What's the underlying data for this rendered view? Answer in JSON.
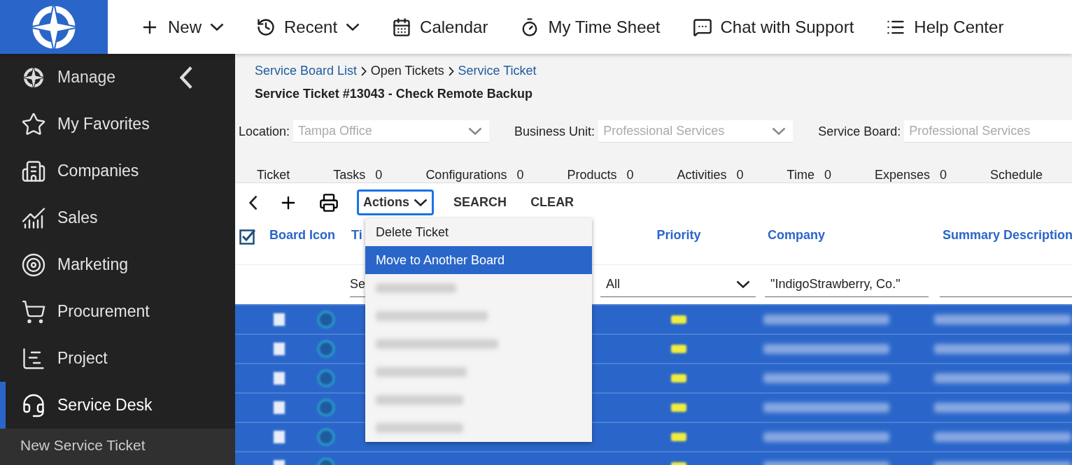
{
  "top_nav": [
    {
      "label": "New",
      "dropdown": true
    },
    {
      "label": "Recent",
      "dropdown": true
    },
    {
      "label": "Calendar",
      "dropdown": false
    },
    {
      "label": "My Time Sheet",
      "dropdown": false
    },
    {
      "label": "Chat with Support",
      "dropdown": false
    },
    {
      "label": "Help Center",
      "dropdown": false
    }
  ],
  "sidebar": {
    "header": "Manage",
    "items": [
      {
        "label": "My Favorites",
        "selected": false
      },
      {
        "label": "Companies",
        "selected": false
      },
      {
        "label": "Sales",
        "selected": false
      },
      {
        "label": "Marketing",
        "selected": false
      },
      {
        "label": "Procurement",
        "selected": false
      },
      {
        "label": "Project",
        "selected": false
      },
      {
        "label": "Service Desk",
        "selected": true
      }
    ],
    "sub_items": [
      {
        "label": "New Service Ticket"
      }
    ]
  },
  "breadcrumb": [
    {
      "label": "Service Board List",
      "link": true
    },
    {
      "label": "Open Tickets",
      "link": false
    },
    {
      "label": "Service Ticket",
      "link": true
    }
  ],
  "title": "Service Ticket #13043 - Check Remote Backup",
  "fields": [
    {
      "label": "Location:",
      "value": "Tampa Office",
      "disabled": true
    },
    {
      "label": "Business Unit:",
      "value": "Professional Services",
      "disabled": true
    },
    {
      "label": "Service Board:",
      "value": "Professional Services",
      "disabled": true
    }
  ],
  "tabs": [
    {
      "label": "Ticket"
    },
    {
      "label": "Tasks",
      "count": "0"
    },
    {
      "label": "Configurations",
      "count": "0"
    },
    {
      "label": "Products",
      "count": "0"
    },
    {
      "label": "Activities",
      "count": "0"
    },
    {
      "label": "Time",
      "count": "0"
    },
    {
      "label": "Expenses",
      "count": "0"
    },
    {
      "label": "Schedule"
    }
  ],
  "toolbar": {
    "actions": {
      "label": "Actions",
      "open": true
    },
    "buttons": [
      "SEARCH",
      "CLEAR"
    ]
  },
  "menu": [
    {
      "kind": "text",
      "label": "Delete Ticket",
      "selected": false
    },
    {
      "kind": "text",
      "label": "Move to Another Board",
      "selected": true
    },
    {
      "kind": "redacted"
    },
    {
      "kind": "redacted"
    },
    {
      "kind": "redacted"
    },
    {
      "kind": "redacted"
    },
    {
      "kind": "redacted"
    },
    {
      "kind": "redacted"
    }
  ],
  "table": {
    "select_all_checked": true,
    "columns": [
      {
        "label": "Board Icon"
      },
      {
        "label": "Ti",
        "filter": {
          "kind": "text",
          "value": "Se"
        }
      },
      {
        "label": "Priority",
        "filter": {
          "kind": "select",
          "value": "All"
        }
      },
      {
        "label": "Company",
        "filter": {
          "kind": "text",
          "value": "\"IndigoStrawberry, Co.\""
        }
      },
      {
        "label": "Summary Description",
        "filter": {
          "kind": "text"
        }
      }
    ],
    "rows": [
      {
        "selected": true
      },
      {
        "selected": true
      },
      {
        "selected": true
      },
      {
        "selected": true
      },
      {
        "selected": true
      },
      {
        "selected": true
      }
    ]
  }
}
